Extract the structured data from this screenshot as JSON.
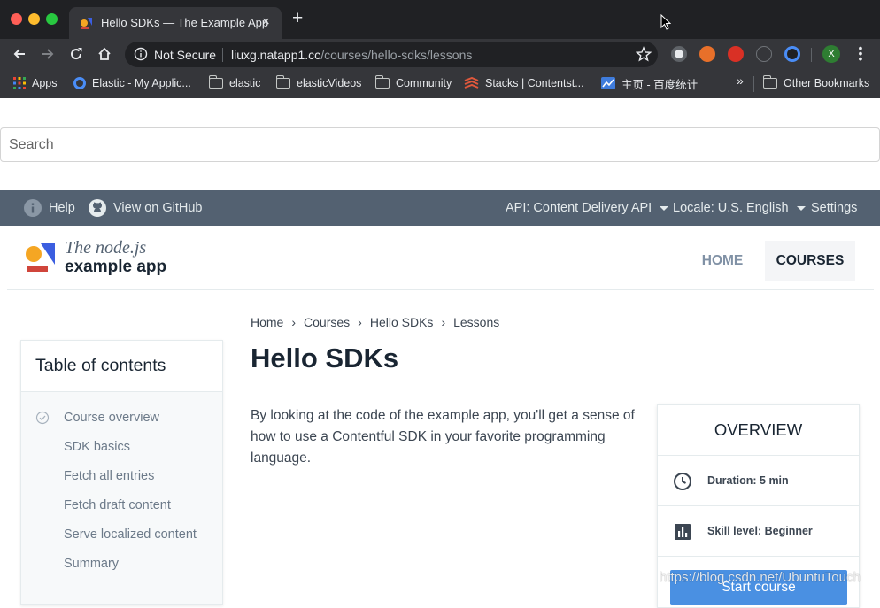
{
  "browser": {
    "tab_title": "Hello SDKs — The Example App",
    "tab_close": "×",
    "new_tab": "+",
    "security_label": "Not Secure",
    "url_host": "liuxg.natapp1.cc",
    "url_path": "/courses/hello-sdks/lessons",
    "profile_initial": "X",
    "bookmarks": {
      "apps": "Apps",
      "elastic_app": "Elastic - My Applic...",
      "elastic": "elastic",
      "elastic_videos": "elasticVideos",
      "community": "Community",
      "stacks": "Stacks | Contentst...",
      "baidu": "主页 - 百度统计",
      "more": "»",
      "other": "Other Bookmarks"
    }
  },
  "search": {
    "placeholder": "Search"
  },
  "infobar": {
    "help": "Help",
    "github": "View on GitHub",
    "api": "API: Content Delivery API",
    "locale": "Locale: U.S. English",
    "settings": "Settings"
  },
  "header": {
    "logo_line1": "The node.js",
    "logo_line2": "example app",
    "nav_home": "HOME",
    "nav_courses": "COURSES"
  },
  "breadcrumb": [
    "Home",
    "Courses",
    "Hello SDKs",
    "Lessons"
  ],
  "breadcrumb_sep": "›",
  "page_title": "Hello SDKs",
  "toc": {
    "title": "Table of contents",
    "items": [
      "Course overview",
      "SDK basics",
      "Fetch all entries",
      "Fetch draft content",
      "Serve localized content",
      "Summary"
    ]
  },
  "intro": "By looking at the code of the example app, you'll get a sense of how to use a Contentful SDK in your favorite programming language.",
  "overview": {
    "title": "OVERVIEW",
    "duration": "Duration: 5 min",
    "skill": "Skill level: Beginner",
    "start_button": "Start course"
  },
  "watermark": "https://blog.csdn.net/UbuntuTouch",
  "colors": {
    "infobar_bg": "#536171",
    "brand_dark": "#192532",
    "button_blue": "#4a90e2",
    "logo_yellow": "#f5a623",
    "logo_red": "#d0453b",
    "logo_blue": "#3b5ee0"
  }
}
